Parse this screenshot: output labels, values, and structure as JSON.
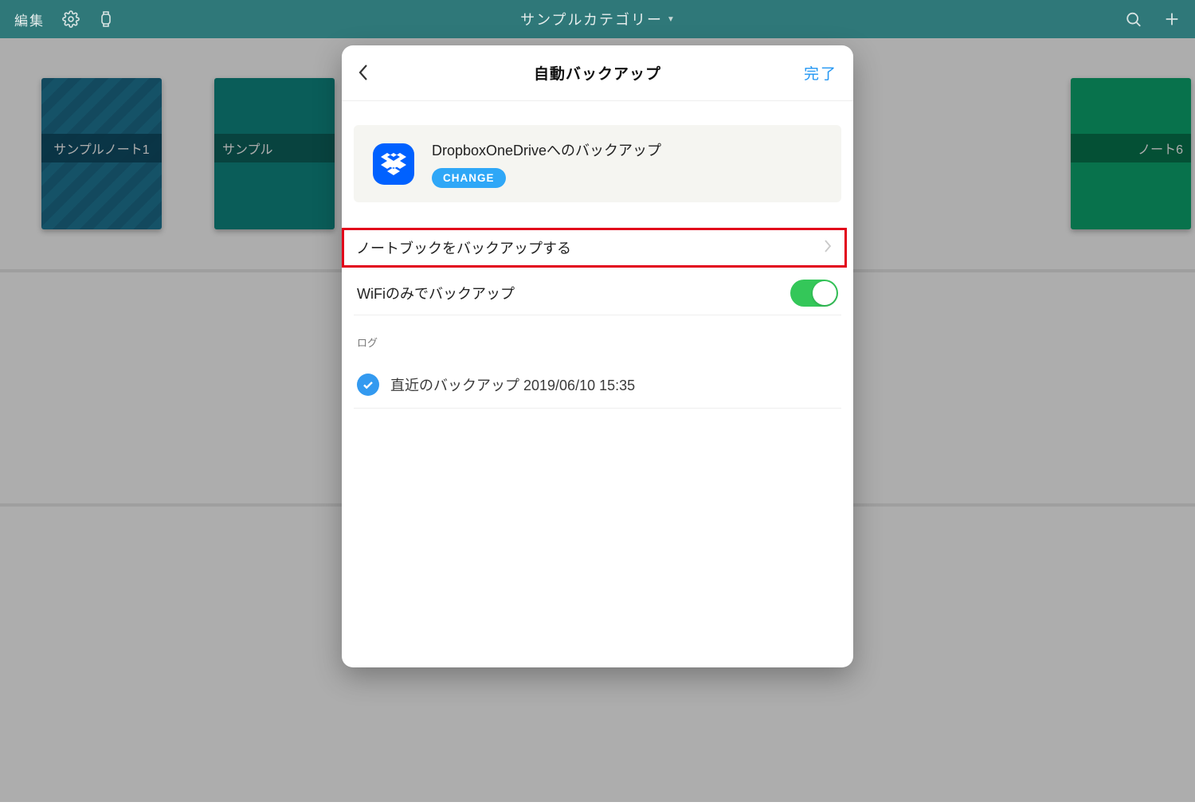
{
  "navbar": {
    "edit_label": "編集",
    "title": "サンプルカテゴリー"
  },
  "notebooks": {
    "n1": "サンプルノート1",
    "n2": "サンプル",
    "n3": "ノート6"
  },
  "modal": {
    "title": "自動バックアップ",
    "done": "完了",
    "backup_service": "DropboxOneDriveへのバックアップ",
    "change": "CHANGE",
    "backup_notebooks": "ノートブックをバックアップする",
    "wifi_only": "WiFiのみでバックアップ",
    "log_header": "ログ",
    "last_backup": "直近のバックアップ 2019/06/10 15:35"
  }
}
